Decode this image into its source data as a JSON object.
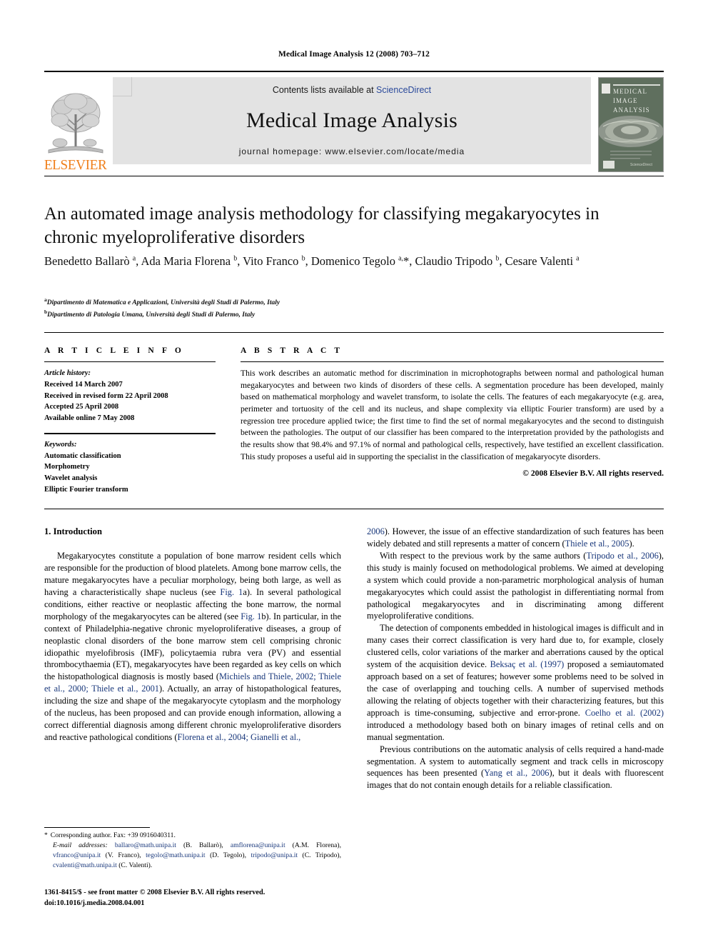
{
  "running_head": "Medical Image Analysis 12 (2008) 703–712",
  "masthead": {
    "publisher_name": "ELSEVIER",
    "contents_prefix": "Contents lists available at ",
    "sciencedirect": "ScienceDirect",
    "journal_name": "Medical Image Analysis",
    "homepage": "journal homepage: www.elsevier.com/locate/media",
    "cover_lines": [
      "MEDICAL",
      "IMAGE",
      "ANALYSIS"
    ],
    "cover_footer_brand": "ScienceDirect",
    "accent_orange": "#F07F1A",
    "link_blue": "#2b4a9b",
    "cover_green": "#5f6f5e"
  },
  "article": {
    "title": "An automated image analysis methodology for classifying megakaryocytes in chronic myeloproliferative disorders",
    "authors_html": "Benedetto Ballarò <sup>a</sup>, Ada Maria Florena <sup>b</sup>, Vito Franco <sup>b</sup>, Domenico Tegolo <sup>a,</sup>*, Claudio Tripodo <sup>b</sup>, Cesare Valenti <sup>a</sup>",
    "affiliations": [
      "Dipartimento di Matematica e Applicazioni, Università degli Studi di Palermo, Italy",
      "Dipartimento di Patologia Umana, Università degli Studi di Palermo, Italy"
    ],
    "affiliation_marks": [
      "a",
      "b"
    ]
  },
  "info": {
    "heading": "A R T I C L E   I N F O",
    "history_label": "Article history:",
    "history": [
      "Received 14 March 2007",
      "Received in revised form 22 April 2008",
      "Accepted 25 April 2008",
      "Available online 7 May 2008"
    ],
    "keywords_label": "Keywords:",
    "keywords": [
      "Automatic classification",
      "Morphometry",
      "Wavelet analysis",
      "Elliptic Fourier transform"
    ]
  },
  "abstract": {
    "heading": "A B S T R A C T",
    "text": "This work describes an automatic method for discrimination in microphotographs between normal and pathological human megakaryocytes and between two kinds of disorders of these cells. A segmentation procedure has been developed, mainly based on mathematical morphology and wavelet transform, to isolate the cells. The features of each megakaryocyte (e.g. area, perimeter and tortuosity of the cell and its nucleus, and shape complexity via elliptic Fourier transform) are used by a regression tree procedure applied twice; the first time to find the set of normal megakaryocytes and the second to distinguish between the pathologies. The output of our classifier has been compared to the interpretation provided by the pathologists and the results show that 98.4% and 97.1% of normal and pathological cells, respectively, have testified an excellent classification. This study proposes a useful aid in supporting the specialist in the classification of megakaryocyte disorders.",
    "copyright": "© 2008 Elsevier B.V. All rights reserved."
  },
  "body": {
    "section_heading": "1. Introduction",
    "left_paragraphs": [
      {
        "segments": [
          {
            "t": "Megakaryocytes constitute a population of bone marrow resident cells which are responsible for the production of blood platelets. Among bone marrow cells, the mature megakaryocytes have a peculiar morphology, being both large, as well as having a characteristically shape nucleus (see ",
            "k": "text"
          },
          {
            "t": "Fig. 1",
            "k": "link"
          },
          {
            "t": "a). In several pathological conditions, either reactive or neoplastic affecting the bone marrow, the normal morphology of the megakaryocytes can be altered (see ",
            "k": "text"
          },
          {
            "t": "Fig. 1",
            "k": "link"
          },
          {
            "t": "b). In particular, in the context of Philadelphia-negative chronic myeloproliferative diseases, a group of neoplastic clonal disorders of the bone marrow stem cell comprising chronic idiopathic myelofibrosis (IMF), policytaemia rubra vera (PV) and essential thrombocythaemia (ET), megakaryocytes have been regarded as key cells on which the histopathological diagnosis is mostly based (",
            "k": "text"
          },
          {
            "t": "Michiels and Thiele, 2002; Thiele et al., 2000; Thiele et al., 2001",
            "k": "link"
          },
          {
            "t": "). Actually, an array of histopathological features, including the size and shape of the megakaryocyte cytoplasm and the morphology of the nucleus, has been proposed and can provide enough information, allowing a correct differential diagnosis among different chronic myeloproliferative disorders and reactive pathological conditions (",
            "k": "text"
          },
          {
            "t": "Florena et al., 2004; Gianelli et al.,",
            "k": "link"
          }
        ]
      }
    ],
    "right_paragraphs": [
      {
        "segments": [
          {
            "t": "2006",
            "k": "link"
          },
          {
            "t": "). However, the issue of an effective standardization of such features has been widely debated and still represents a matter of concern (",
            "k": "text"
          },
          {
            "t": "Thiele et al., 2005",
            "k": "link"
          },
          {
            "t": ").",
            "k": "text"
          }
        ],
        "indent": false
      },
      {
        "segments": [
          {
            "t": "With respect to the previous work by the same authors (",
            "k": "text"
          },
          {
            "t": "Tripodo et al., 2006",
            "k": "link"
          },
          {
            "t": "), this study is mainly focused on methodological problems. We aimed at developing a system which could provide a non-parametric morphological analysis of human megakaryocytes which could assist the pathologist in differentiating normal from pathological megakaryocytes and in discriminating among different myeloproliferative conditions.",
            "k": "text"
          }
        ],
        "indent": true
      },
      {
        "segments": [
          {
            "t": "The detection of components embedded in histological images is difficult and in many cases their correct classification is very hard due to, for example, closely clustered cells, color variations of the marker and aberrations caused by the optical system of the acquisition device. ",
            "k": "text"
          },
          {
            "t": "Beksaç et al. (1997)",
            "k": "link"
          },
          {
            "t": " proposed a semiautomated approach based on a set of features; however some problems need to be solved in the case of overlapping and touching cells. A number of supervised methods allowing the relating of objects together with their characterizing features, but this approach is time-consuming, subjective and error-prone. ",
            "k": "text"
          },
          {
            "t": "Coelho et al. (2002)",
            "k": "link"
          },
          {
            "t": " introduced a methodology based both on binary images of retinal cells and on manual segmentation.",
            "k": "text"
          }
        ],
        "indent": true
      },
      {
        "segments": [
          {
            "t": "Previous contributions on the automatic analysis of cells required a hand-made segmentation. A system to automatically segment and track cells in microscopy sequences has been presented (",
            "k": "text"
          },
          {
            "t": "Yang et al., 2006",
            "k": "link"
          },
          {
            "t": "), but it deals with fluorescent images that do not contain enough details for a reliable classification.",
            "k": "text"
          }
        ],
        "indent": true
      }
    ]
  },
  "footnotes": {
    "corresponding": "Corresponding author. Fax: +39 0916040311.",
    "email_label": "E-mail addresses:",
    "emails": [
      {
        "addr": "ballaro@math.unipa.it",
        "who": "(B. Ballarò)"
      },
      {
        "addr": "amflorena@unipa.it",
        "who": "(A.M. Florena)"
      },
      {
        "addr": "vfranco@unipa.it",
        "who": "(V. Franco)"
      },
      {
        "addr": "tegolo@math.unipa.it",
        "who": "(D. Tegolo)"
      },
      {
        "addr": "tripodo@unipa.it",
        "who": "(C. Tripodo)"
      },
      {
        "addr": "cvalenti@math.unipa.it",
        "who": "(C. Valenti)"
      }
    ],
    "issn_line": "1361-8415/$ - see front matter © 2008 Elsevier B.V. All rights reserved.",
    "doi_line": "doi:10.1016/j.media.2008.04.001"
  }
}
